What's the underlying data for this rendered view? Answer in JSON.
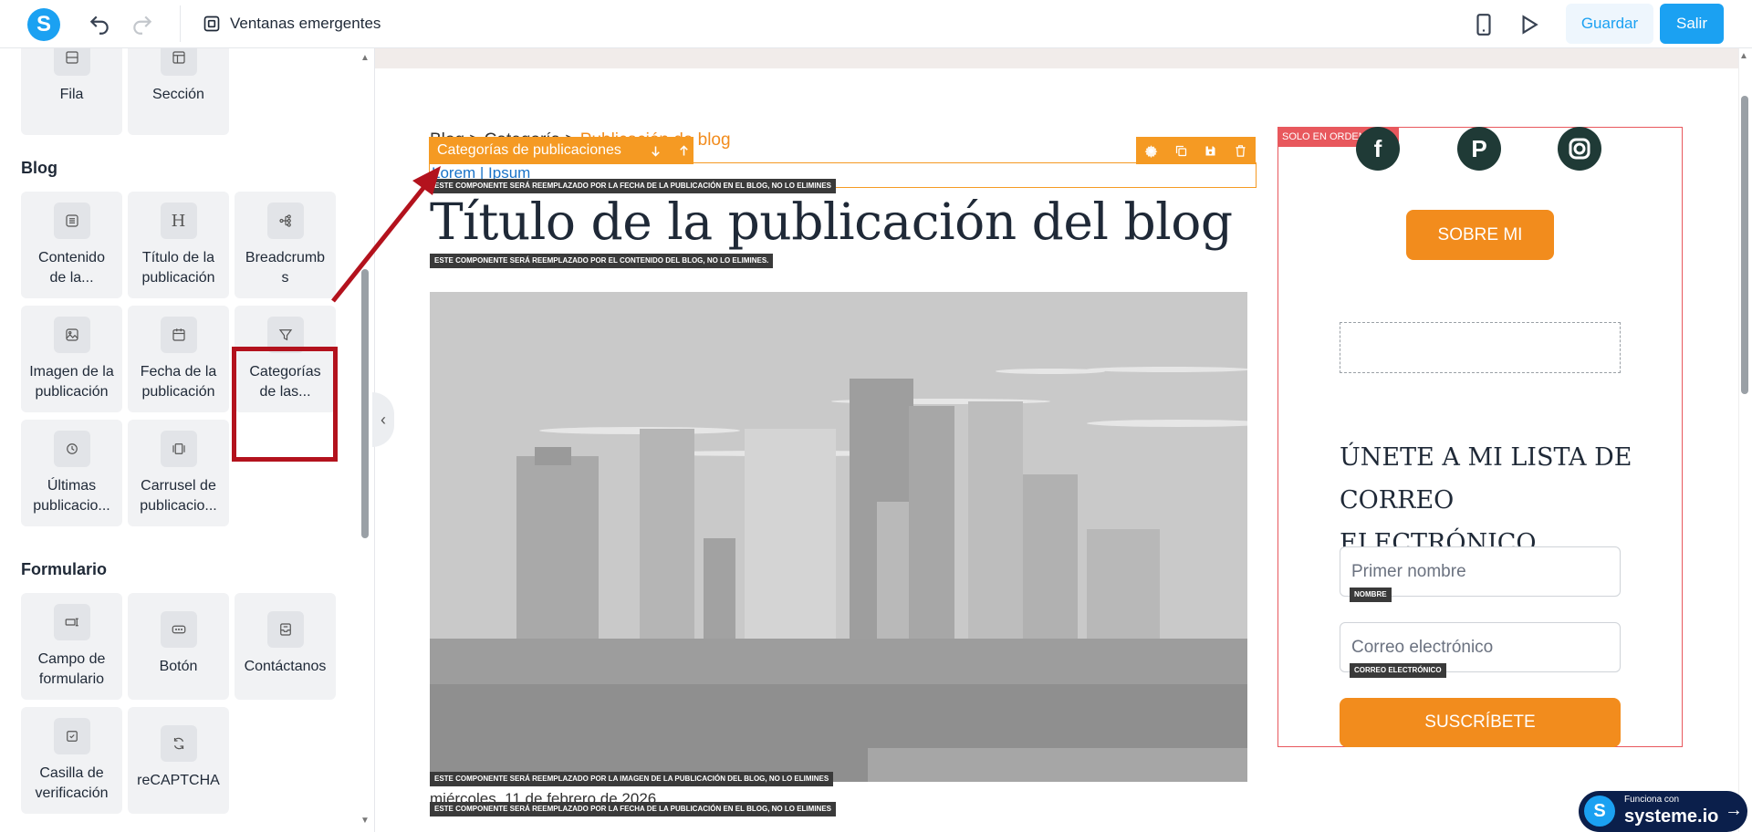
{
  "topbar": {
    "popup_label": "Ventanas emergentes",
    "save_label": "Guardar",
    "exit_label": "Salir",
    "logo_letter": "S"
  },
  "panel": {
    "layout_tiles": [
      {
        "label": "Fila",
        "icon": "row-icon"
      },
      {
        "label": "Sección",
        "icon": "section-icon"
      }
    ],
    "blog_title": "Blog",
    "blog_tiles": [
      {
        "label": "Contenido de la...",
        "icon": "content-icon"
      },
      {
        "label": "Título de la publicación",
        "icon": "heading-icon"
      },
      {
        "label": "Breadcrumb s",
        "icon": "breadcrumbs-icon"
      },
      {
        "label": "Imagen de la publicación",
        "icon": "image-icon"
      },
      {
        "label": "Fecha de la publicación",
        "icon": "calendar-icon"
      },
      {
        "label": "Categorías de las...",
        "icon": "filter-icon"
      },
      {
        "label": "Últimas publicacio...",
        "icon": "clock-icon"
      },
      {
        "label": "Carrusel de publicacio...",
        "icon": "carousel-icon"
      }
    ],
    "form_title": "Formulario",
    "form_tiles": [
      {
        "label": "Campo de formulario",
        "icon": "form-field-icon"
      },
      {
        "label": "Botón",
        "icon": "button-icon"
      },
      {
        "label": "Contáctanos",
        "icon": "contact-icon"
      },
      {
        "label": "Casilla de verificación",
        "icon": "checkbox-icon"
      },
      {
        "label": "reCAPTCHA",
        "icon": "recaptcha-icon"
      }
    ]
  },
  "canvas": {
    "breadcrumb": {
      "prefix": "Blog > Categoría > ",
      "current": "Publicación de blog"
    },
    "selection_label": "Categorías de publicaciones",
    "category_links": "Lorem | Ipsum",
    "tag_date": "ESTE COMPONENTE SERÁ REEMPLAZADO POR LA FECHA DE LA PUBLICACIÓN EN EL BLOG, NO LO ELIMINES",
    "post_title": "Título de la publicación del blog",
    "tag_content": "ESTE COMPONENTE SERÁ REEMPLAZADO POR EL CONTENIDO DEL BLOG, NO LO ELIMINES.",
    "tag_image": "ESTE COMPONENTE SERÁ REEMPLAZADO POR LA IMAGEN DE LA PUBLICACIÓN DEL BLOG, NO LO ELIMINES",
    "post_date": "miércoles, 11 de febrero de 2026",
    "tag_date2": "ESTE COMPONENTE SERÁ REEMPLAZADO POR LA FECHA DE LA PUBLICACIÓN EN EL BLOG, NO LO ELIMINES"
  },
  "aside": {
    "desktop_only_tag": "SOLO EN ORDENADOR",
    "about_button": "SOBRE MI",
    "optin_title": "ÚNETE A MI LISTA DE CORREO ELECTRÓNICO",
    "first_name_placeholder": "Primer nombre",
    "first_name_tag": "NOMBRE",
    "email_placeholder": "Correo electrónico",
    "email_tag": "CORREO ELECTRÓNICO",
    "subscribe_button": "SUSCRÍBETE"
  },
  "badge": {
    "line1": "Funciona con",
    "line2": "systeme.io"
  },
  "colors": {
    "accent": "#1ba1f2",
    "orange": "#f28c1d",
    "annotation_red": "#b3121d"
  }
}
